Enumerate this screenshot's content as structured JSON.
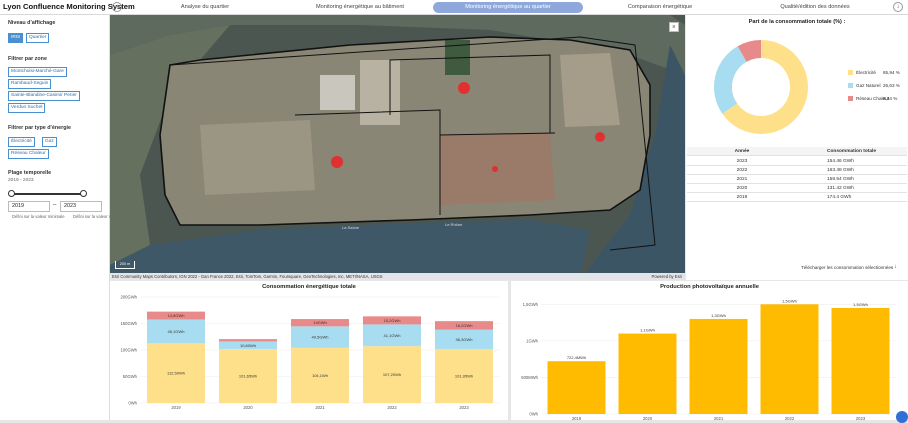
{
  "app": {
    "title": "Lyon Confluence Monitoring System"
  },
  "header": {
    "home_icon": "home-icon",
    "download_icon": "download-icon",
    "tabs": [
      {
        "label": "Analyse du quartier",
        "active": false
      },
      {
        "label": "Monitoring énergétique au bâtiment",
        "active": false
      },
      {
        "label": "Monitoring énergétique au quartier",
        "active": true
      },
      {
        "label": "Comparaison énergétique",
        "active": false
      },
      {
        "label": "Qualité/édition des données",
        "active": false
      }
    ]
  },
  "sidebar": {
    "level_heading": "Niveau d'affichage",
    "level_options": [
      "IRIS",
      "Quartier"
    ],
    "zone_heading": "Filtrer par zone",
    "zones": [
      "Montchoisi-Marché-Gare",
      "Rambaud-Seguin",
      "Sainte-Blandine-Casimir Perier",
      "Verdun Suchet"
    ],
    "energy_heading": "Filtrer par type d'énergie",
    "energies": [
      "Électricité",
      "Gaz",
      "Réseau Chaleur"
    ],
    "period_heading": "Plage temporelle",
    "period_range": "2019 - 2023",
    "year_start": "2019",
    "year_end": "2023",
    "min_label": "Défini sur la valeur minimale",
    "max_label": "Défini sur la valeur maximale"
  },
  "map": {
    "attribution": "Esri Community Maps Contributors, IGN 2022 - Gan France 2022, Esri, TomTom, Garmin, Foursquare, GeoTechnologies, Inc, METI/NASA, USGS",
    "powered_by": "Powered by Esri",
    "river_label_1": "La Saône",
    "river_label_2": "Le Rhône",
    "scale_label": "200 m",
    "layers_icon": "layers-icon"
  },
  "pie": {
    "title": "Part de la consommation totale (%) :",
    "colors": {
      "elec": "#ffe08a",
      "gaz": "#a8dcf0",
      "rc": "#e88a8a"
    },
    "legend": [
      {
        "label": "Électricité",
        "value": "65,94 %"
      },
      {
        "label": "Gaz Naturel",
        "value": "26,63 %"
      },
      {
        "label": "Réseau Chaleur",
        "value": "8,34 %"
      }
    ],
    "shares": [
      65.94,
      26.63,
      8.34
    ]
  },
  "table": {
    "headers": [
      "Année",
      "Consommation totale"
    ],
    "rows": [
      [
        "2023",
        "154.46 GWh"
      ],
      [
        "2022",
        "163.48 GWh"
      ],
      [
        "2021",
        "158.54 GWh"
      ],
      [
        "2020",
        "131.42 GWh"
      ],
      [
        "2019",
        "174.4 GWh"
      ]
    ],
    "download_label": "Télécharger les consommation sélectionnées"
  },
  "chart_data": [
    {
      "type": "bar",
      "title": "Consommation énergétique totale",
      "categories": [
        "2019",
        "2020",
        "2021",
        "2022",
        "2023"
      ],
      "stacked": true,
      "ylim": [
        0,
        200
      ],
      "yticks": [
        "0Wh",
        "50GWh",
        "100GWh",
        "150GWh",
        "200GWh"
      ],
      "series": [
        {
          "values": [
            112.5,
            101.65,
            104.1,
            107.2,
            101.95
          ],
          "labels": [
            "112,50Wh",
            "101,65Wh",
            "104,1Wh",
            "107,20Wh",
            "101,95Wh"
          ],
          "color": "#ffe08a"
        },
        {
          "values": [
            45.1,
            14.5,
            40.5,
            41.1,
            36.3
          ],
          "labels": [
            "45,1GWh",
            "10,60Wh",
            "40,5GWh",
            "41,1GWh",
            "36,3GWh"
          ],
          "color": "#a8dcf0"
        },
        {
          "values": [
            14.8,
            4.4,
            13.8,
            15.2,
            16.2
          ],
          "labels": [
            "14,8GWh",
            "",
            "14GWh",
            "15,2GWh",
            "16,2GWh"
          ],
          "color": "#e88a8a"
        }
      ]
    },
    {
      "type": "bar",
      "title": "Production photovoltaïque annuelle",
      "categories": [
        "2019",
        "2020",
        "2021",
        "2022",
        "2023"
      ],
      "ylim": [
        0,
        1.6
      ],
      "yticks": [
        "0Wh",
        "500MWh",
        "1GWh",
        "1,5GWh"
      ],
      "series": [
        {
          "values": [
            0.722,
            1.1,
            1.3,
            1.5,
            1.45
          ],
          "labels": [
            "722,4MWh",
            "1,1GWh",
            "1,3GWh",
            "1,5GWh",
            "1,5GWh"
          ],
          "color": "#ffbb00"
        }
      ]
    }
  ]
}
